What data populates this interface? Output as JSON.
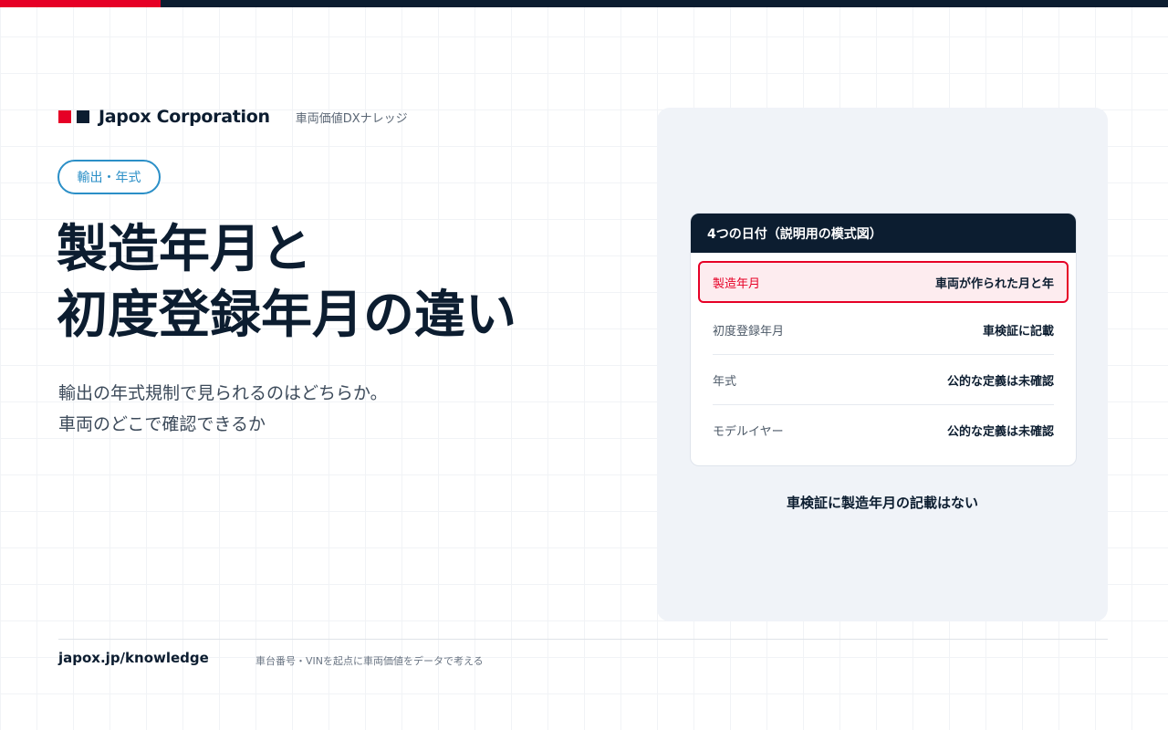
{
  "brand": {
    "name": "Japox Corporation",
    "subtitle": "車両価値DXナレッジ"
  },
  "tag": "輸出・年式",
  "title": {
    "line1": "製造年月と",
    "line2": "初度登録年月の違い"
  },
  "subtitle": {
    "line1": "輸出の年式規制で見られるのはどちらか。",
    "line2": "車両のどこで確認できるか"
  },
  "card": {
    "header": "4つの日付（説明用の模式図）",
    "rows": [
      {
        "label": "製造年月",
        "value": "車両が作られた月と年"
      },
      {
        "label": "初度登録年月",
        "value": "車検証に記載"
      },
      {
        "label": "年式",
        "value": "公的な定義は未確認"
      },
      {
        "label": "モデルイヤー",
        "value": "公的な定義は未確認"
      }
    ]
  },
  "note": "車検証に製造年月の記載はない",
  "footer": {
    "url": "japox.jp/knowledge",
    "tagline": "車台番号・VINを起点に車両価値をデータで考える"
  },
  "colors": {
    "accent": "#e60026",
    "navy": "#0c1d30",
    "tag_blue": "#2b8fc7"
  }
}
